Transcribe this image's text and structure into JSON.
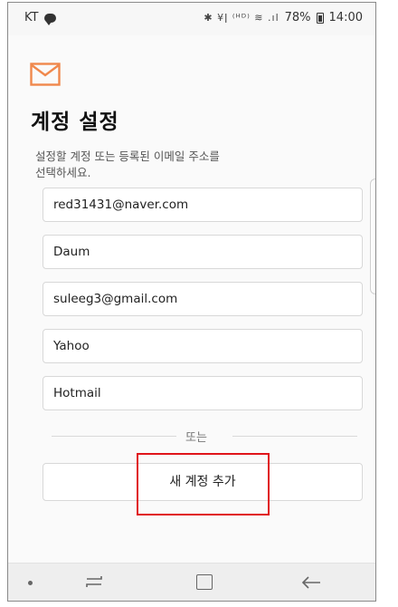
{
  "status_bar": {
    "carrier": "KT",
    "icons": "✱ ¥ǀ ⁽ᴴᴰ⁾ ≋ .ıl",
    "battery": "78%",
    "time": "14:00"
  },
  "header": {
    "icon": "mail-icon",
    "title": "계정 설정"
  },
  "instructions": "설정할 계정 또는 등록된 이메일 주소를\n선택하세요.",
  "accounts": [
    "red31431@naver.com",
    "Daum",
    "suleeg3@gmail.com",
    "Yahoo",
    "Hotmail"
  ],
  "divider_text": "또는",
  "add_account_label": "새 계정 추가",
  "colors": {
    "accent": "#f0884c",
    "highlight": "#e0151b"
  }
}
